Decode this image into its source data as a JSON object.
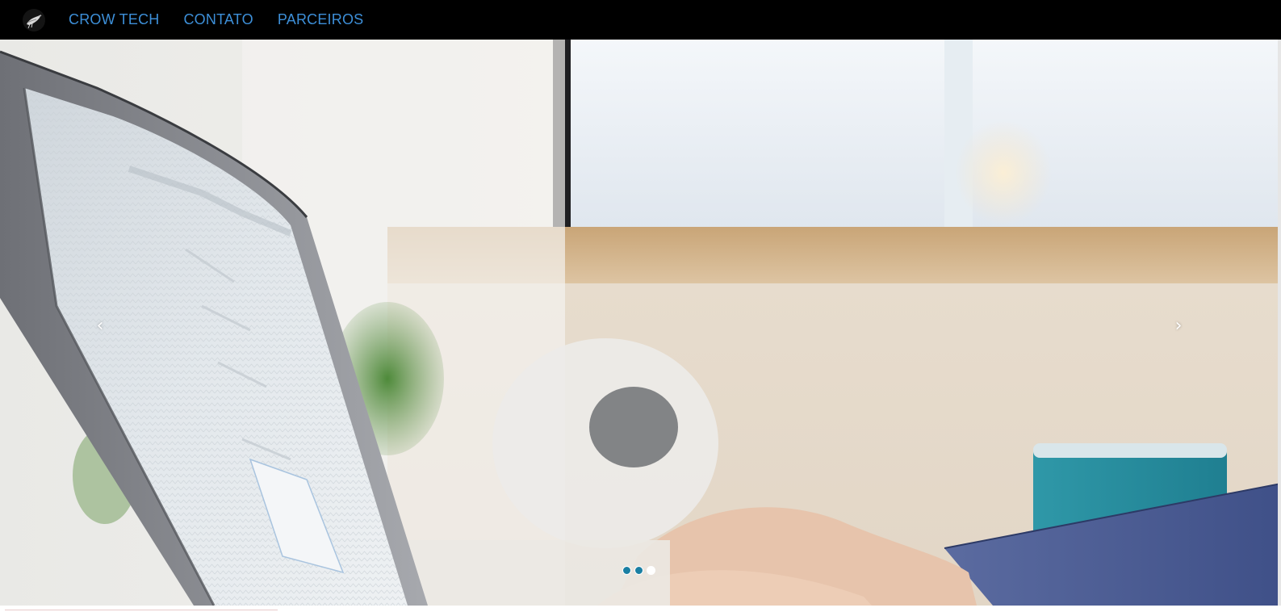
{
  "navbar": {
    "logo_icon": "crow-logo-icon",
    "links": [
      {
        "label": "CROW TECH"
      },
      {
        "label": "CONTATO"
      },
      {
        "label": "PARCEIROS"
      }
    ],
    "link_color": "#3d8fd8",
    "background": "#000000"
  },
  "carousel": {
    "prev_icon": "chevron-left-icon",
    "next_icon": "chevron-right-icon",
    "prev_glyph": "‹",
    "next_glyph": "›",
    "slides_total": 3,
    "active_slide": 3,
    "indicator_active_color": "#ffffff",
    "indicator_inactive_color": "#1a7fa3"
  }
}
